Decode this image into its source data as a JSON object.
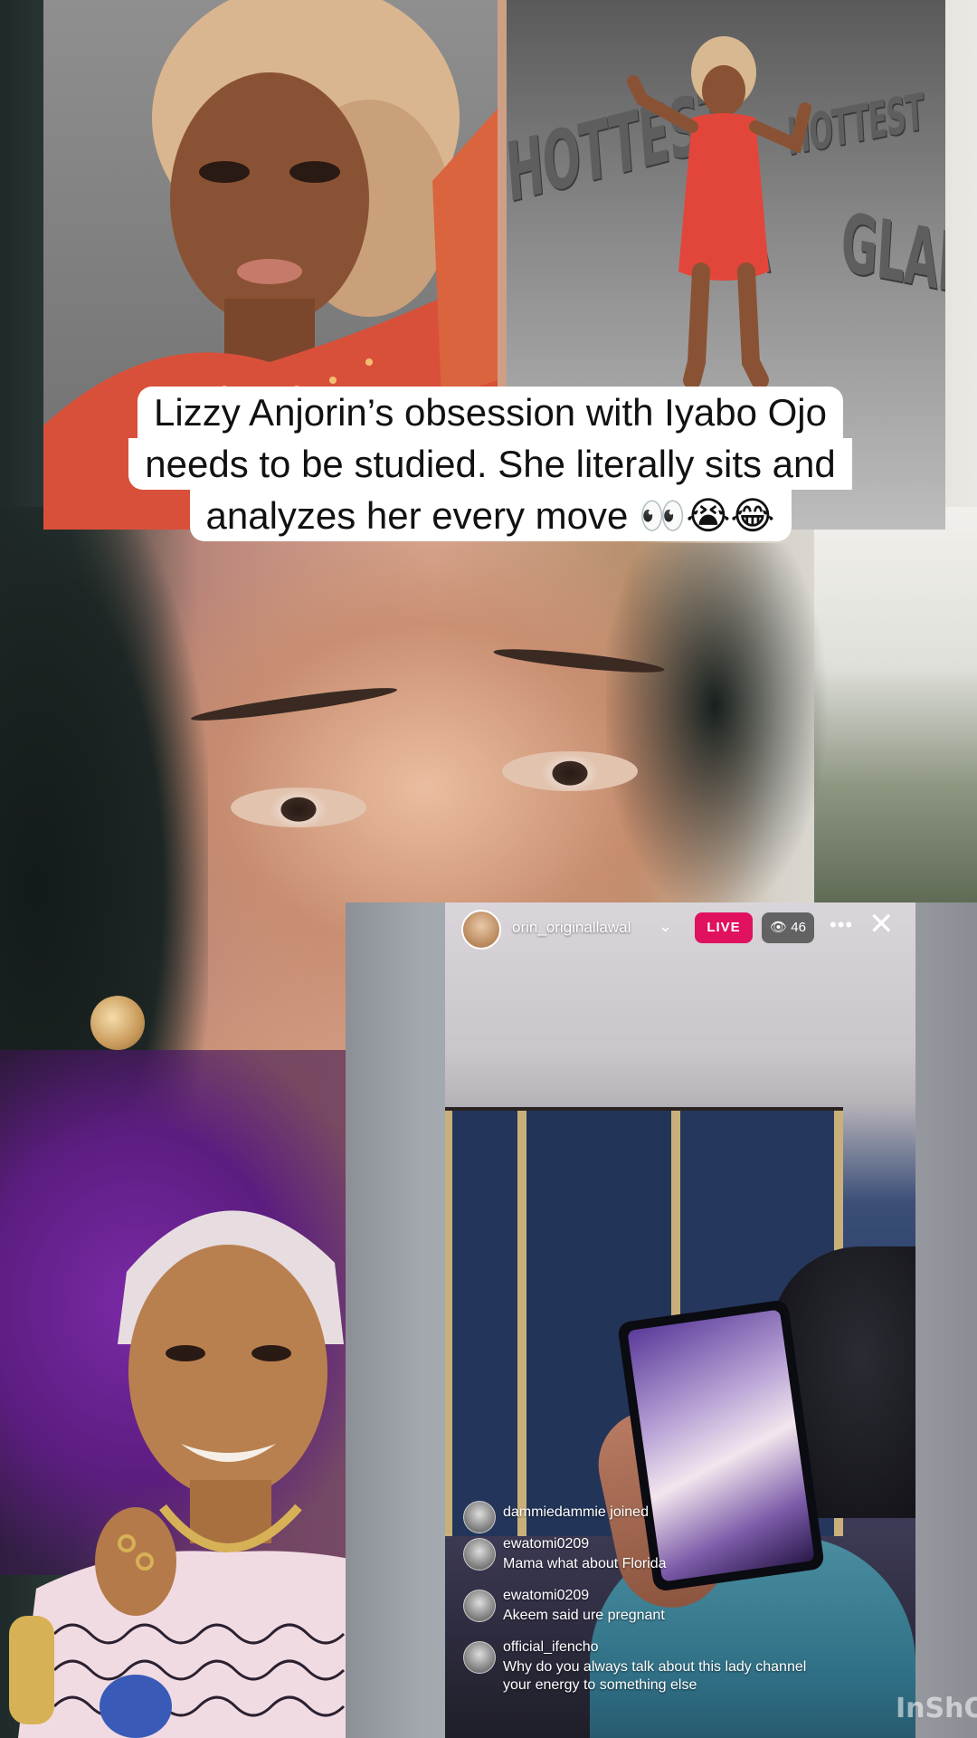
{
  "caption": {
    "line1": "Lizzy Anjorin’s obsession with Iyabo Ojo",
    "line2": "needs to be studied. She literally sits and",
    "line3": "analyzes her every move 👀😭😂"
  },
  "photo_right": {
    "wall_words": [
      "HOTTEST",
      "HOTTEST",
      "GLAMMA",
      "MA"
    ]
  },
  "live": {
    "host_name": "orin_originallawal",
    "live_label": "LIVE",
    "viewer_count": "46",
    "comments": [
      {
        "user": "dammiedammie joined",
        "text": ""
      },
      {
        "user": "ewatomi0209",
        "text": "Mama what about Florida"
      },
      {
        "user": "ewatomi0209",
        "text": "Akeem said ure pregnant"
      },
      {
        "user": "official_ifencho",
        "text": "Why do you always talk about this lady channel"
      },
      {
        "user": "",
        "text": "your energy to something else"
      }
    ]
  },
  "watermark": "InShO",
  "colors": {
    "live_badge": "#e0115f",
    "caption_bg": "#ffffff",
    "caption_text": "#111111"
  }
}
